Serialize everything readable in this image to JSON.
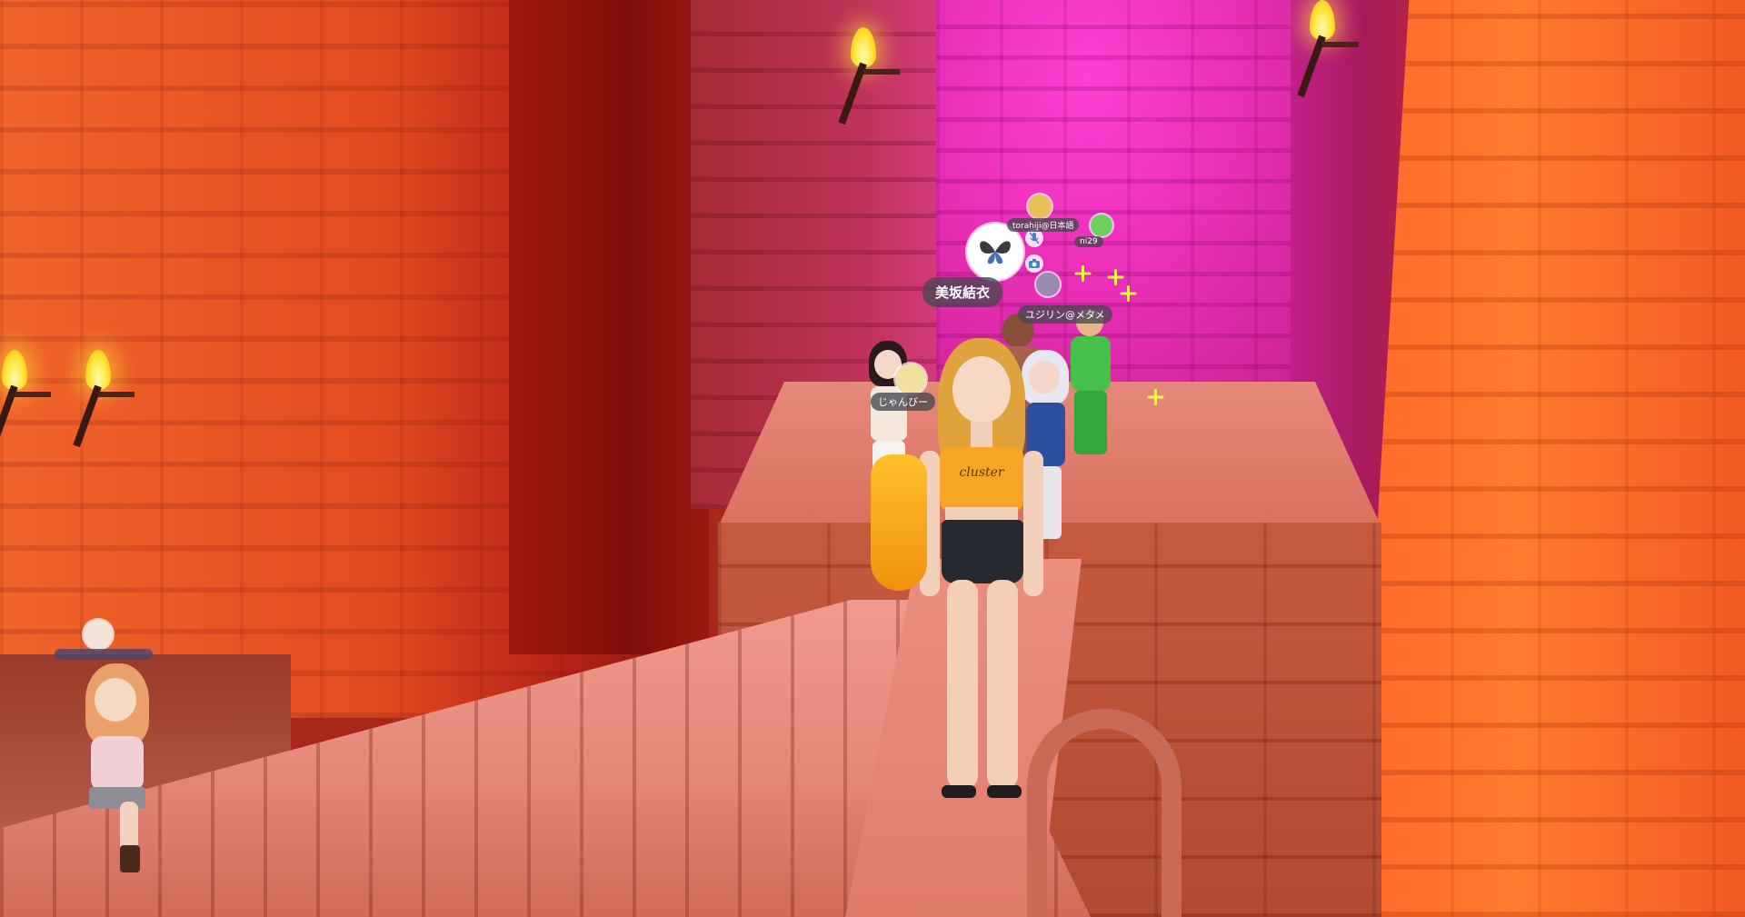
{
  "game": {
    "players": {
      "main_user": {
        "name": "美坂結衣",
        "shirt_text": "cluster"
      },
      "user_1": {
        "name": "torahiji@日本語"
      },
      "user_2": {
        "name": "ni29"
      },
      "user_3": {
        "name": "ユジリン@メタメ"
      },
      "user_4": {
        "name": "じゃんびー"
      }
    },
    "icons": {
      "main_avatar_icon": "butterfly-icon",
      "mic_icon": "microphone-muted-icon",
      "camera_icon": "camera-icon"
    },
    "colors": {
      "nametag_bg": "#464650",
      "flame": "#ffe338",
      "pink_light": "#ff3fd4",
      "orange_wall": "#ff6a2a"
    }
  }
}
